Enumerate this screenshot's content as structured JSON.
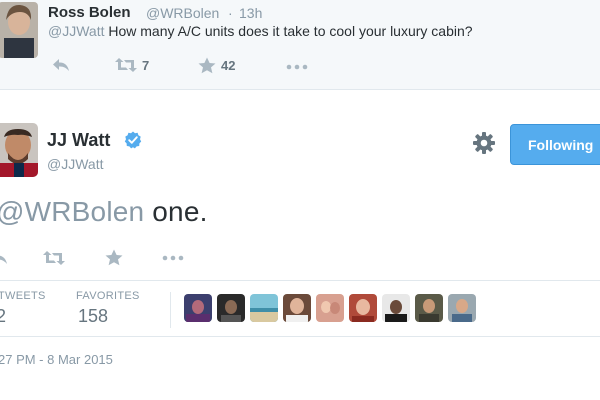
{
  "reply": {
    "name": "Ross Bolen",
    "handle": "@WRBolen",
    "separator": "·",
    "time": "13h",
    "mention": "@JJWatt",
    "text": " How many A/C units does it take to cool your luxury cabin?",
    "retweet_count": "7",
    "favorite_count": "42"
  },
  "tweet": {
    "name": "JJ Watt",
    "handle": "@JJWatt",
    "follow_label": "Following",
    "mention": "@WRBolen",
    "text": " one.",
    "timestamp": "27 PM - 8 Mar 2015"
  },
  "stats": {
    "retweets_label": "TWEETS",
    "retweets_value": "2",
    "favorites_label": "FAVORITES",
    "favorites_value": "158"
  },
  "icons": {
    "reply": "reply-icon",
    "retweet": "retweet-icon",
    "favorite": "star-icon",
    "more": "more-icon",
    "verified": "verified-badge-icon",
    "settings": "gear-icon"
  },
  "colors": {
    "link_blue": "#55acee",
    "muted": "#8899a6",
    "icon_gray": "#aab8c2",
    "reply_bg": "#f5f8fa"
  }
}
